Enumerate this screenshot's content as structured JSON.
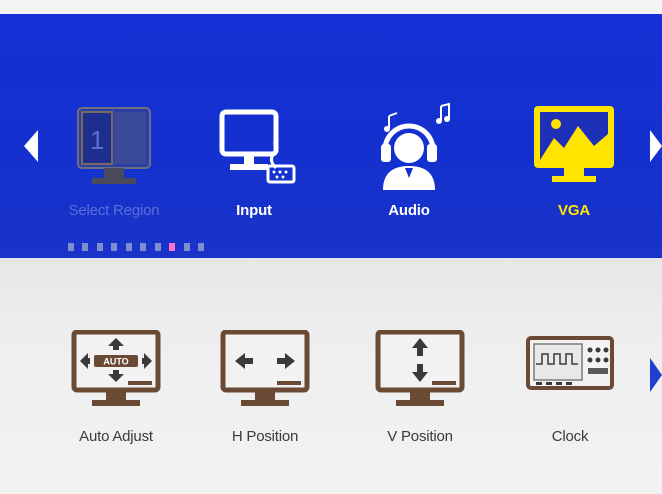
{
  "categories": [
    {
      "label": "Select Region",
      "icon": "select-region-icon",
      "state": "disabled"
    },
    {
      "label": "Input",
      "icon": "input-icon",
      "state": "normal"
    },
    {
      "label": "Audio",
      "icon": "audio-icon",
      "state": "normal"
    },
    {
      "label": "VGA",
      "icon": "vga-icon",
      "state": "selected"
    }
  ],
  "select_region_number": "1",
  "page_indicator": {
    "total": 10,
    "current": 8
  },
  "submenu": [
    {
      "label": "Auto Adjust",
      "icon": "auto-adjust-icon",
      "badge": "AUTO"
    },
    {
      "label": "H Position",
      "icon": "h-position-icon"
    },
    {
      "label": "V Position",
      "icon": "v-position-icon"
    },
    {
      "label": "Clock",
      "icon": "clock-icon"
    }
  ],
  "colors": {
    "header_bg": "#1431cf",
    "body_bg": "#efefef",
    "selected_accent": "#ffe400",
    "page_dot_active": "#ff6fd0",
    "icon_brown": "#6a4a35"
  }
}
